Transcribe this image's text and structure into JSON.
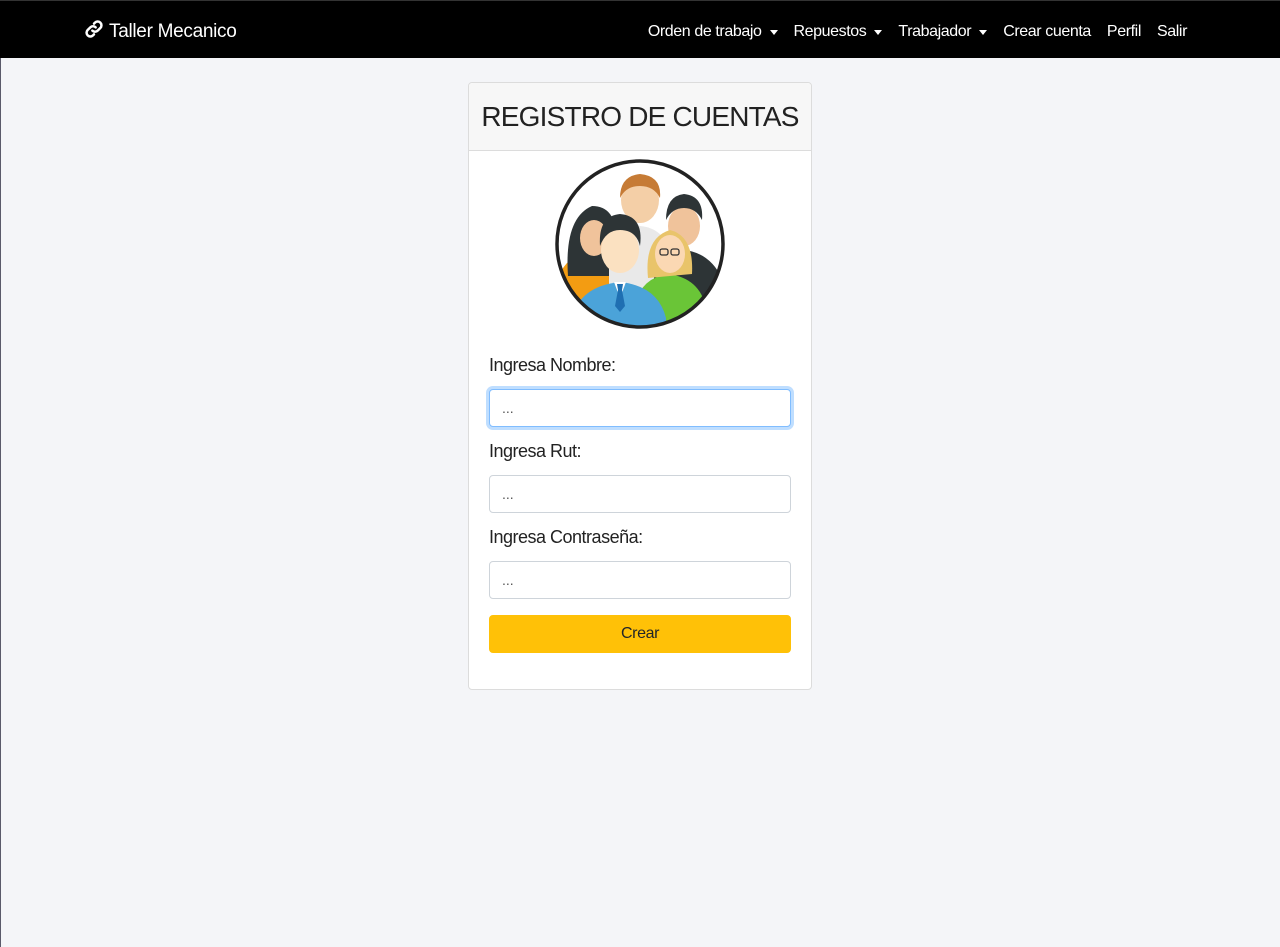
{
  "navbar": {
    "brand": "Taller Mecanico",
    "items": [
      {
        "label": "Orden de trabajo",
        "dropdown": true
      },
      {
        "label": "Repuestos",
        "dropdown": true
      },
      {
        "label": "Trabajador",
        "dropdown": true
      },
      {
        "label": "Crear cuenta",
        "dropdown": false
      },
      {
        "label": "Perfil",
        "dropdown": false
      },
      {
        "label": "Salir",
        "dropdown": false
      }
    ]
  },
  "card": {
    "title": "REGISTRO DE CUENTAS",
    "avatar_icon": "users-group-icon"
  },
  "form": {
    "name_label": "Ingresa Nombre:",
    "name_placeholder": "...",
    "rut_label": "Ingresa Rut:",
    "rut_placeholder": "...",
    "password_label": "Ingresa Contraseña:",
    "password_placeholder": "...",
    "submit_label": "Crear"
  },
  "colors": {
    "navbar_bg": "#000000",
    "page_bg": "#f4f5f8",
    "button_accent": "#ffc107",
    "focus_border": "#80bdff"
  }
}
